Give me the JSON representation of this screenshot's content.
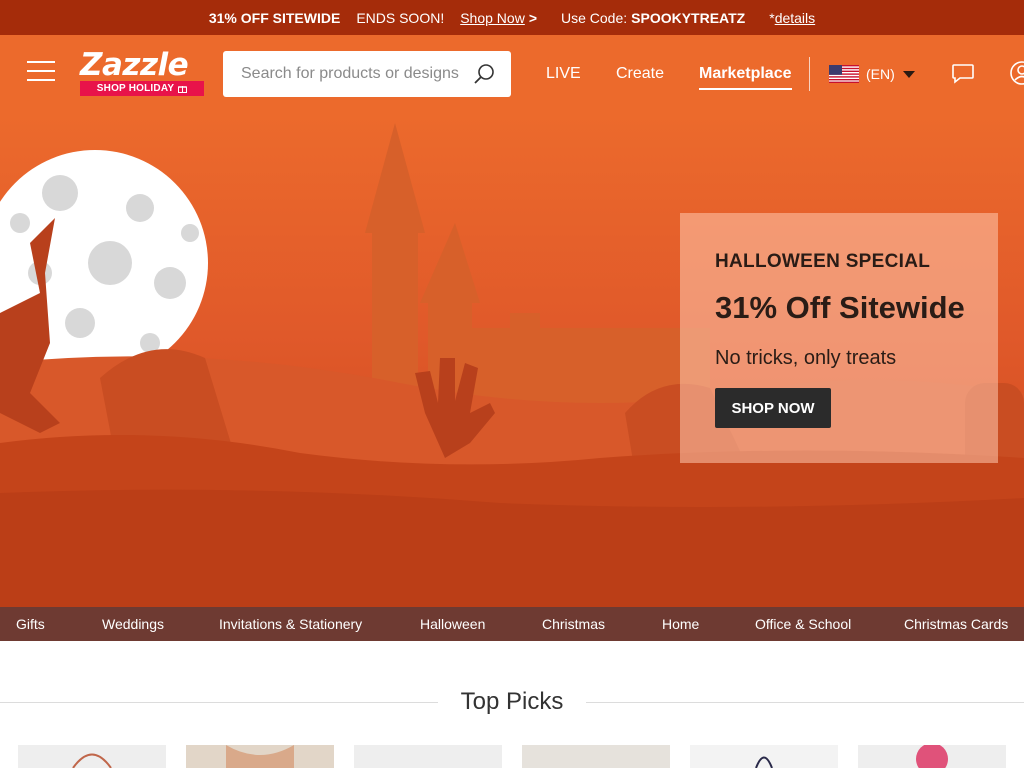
{
  "promo_bar": {
    "offer": "31% OFF SITEWIDE",
    "ends": "ENDS SOON!",
    "shop_now": "Shop Now",
    "arrow": ">",
    "code_label": "Use Code:",
    "code": "SPOOKYTREATZ",
    "details_prefix": "*",
    "details": "details"
  },
  "header": {
    "logo_text": "Zazzle",
    "logo_tag": "SHOP HOLIDAY",
    "search_placeholder": "Search for products or designs",
    "nav": {
      "live": "LIVE",
      "create": "Create",
      "marketplace": "Marketplace"
    },
    "locale": "(EN)",
    "icons": [
      "menu-icon",
      "search-icon",
      "us-flag-icon",
      "caret-down-icon",
      "chat-icon",
      "user-icon"
    ]
  },
  "hero": {
    "kicker": "HALLOWEEN SPECIAL",
    "headline": "31% Off Sitewide",
    "subtext": "No tricks, only treats",
    "cta": "SHOP NOW"
  },
  "categories": [
    "Gifts",
    "Weddings",
    "Invitations & Stationery",
    "Halloween",
    "Christmas",
    "Home",
    "Office & School",
    "Christmas Cards"
  ],
  "top_picks": {
    "title": "Top Picks"
  },
  "colors": {
    "promo_bar": "#a52c0a",
    "header": "#ec6a2c",
    "category_bar": "#6e3a32",
    "logo_tag": "#e8134a",
    "cta": "#2b2b2b"
  }
}
